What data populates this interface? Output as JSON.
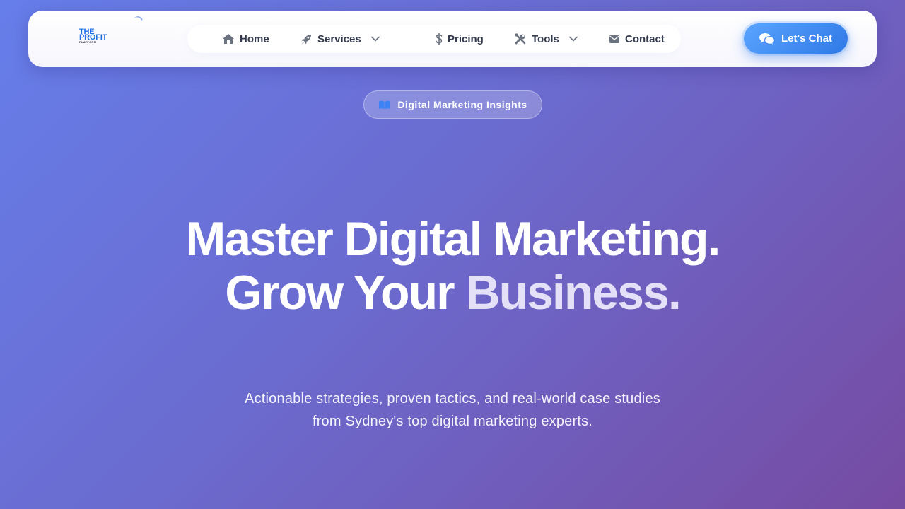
{
  "logo": {
    "line1": "THE",
    "line2": "PROFIT",
    "line3": "PLATFORM"
  },
  "nav": {
    "items": [
      {
        "label": "Home",
        "icon": "home-icon",
        "has_dropdown": false
      },
      {
        "label": "Services",
        "icon": "rocket-icon",
        "has_dropdown": true
      },
      {
        "label": "Pricing",
        "icon": "dollar-icon",
        "has_dropdown": false
      },
      {
        "label": "Tools",
        "icon": "tools-icon",
        "has_dropdown": true
      },
      {
        "label": "Contact",
        "icon": "envelope-icon",
        "has_dropdown": false
      }
    ]
  },
  "cta": {
    "label": "Let's Chat",
    "icon": "chat-bubbles-icon"
  },
  "badge": {
    "label": "Digital Marketing Insights",
    "icon": "open-book-icon"
  },
  "hero": {
    "line1": "Master Digital Marketing.",
    "line2_a": "Grow Your ",
    "line2_b": "Business.",
    "subtitle": "Actionable strategies, proven tactics, and real-world case studies from Sydney's top digital marketing experts."
  },
  "colors": {
    "brand_blue": "#1f6fe0",
    "cta_gradient_start": "#5ba4ff",
    "cta_gradient_end": "#2f79e6",
    "bg_gradient_start": "#667eea",
    "bg_gradient_end": "#764ba2",
    "nav_text": "#333a4d",
    "nav_icon": "#6b7280"
  }
}
